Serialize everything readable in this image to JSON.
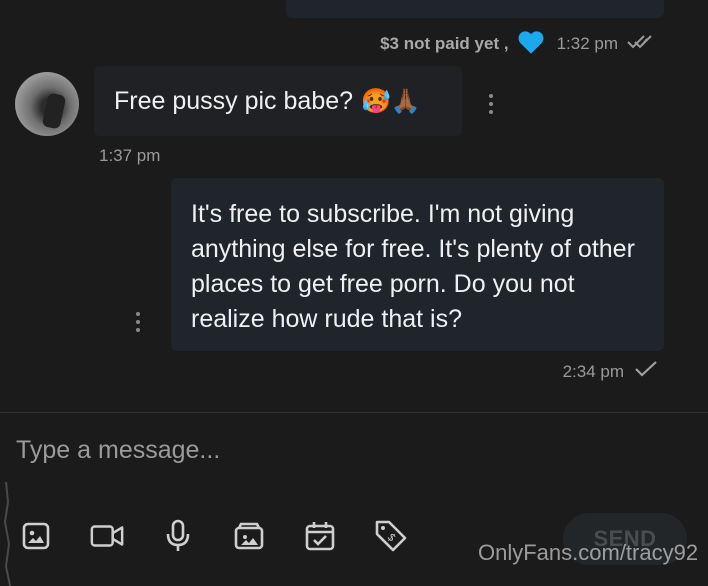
{
  "top_message": {
    "price_status": "$3 not paid yet ,",
    "time": "1:32 pm"
  },
  "received_message": {
    "text": "Free pussy pic babe?",
    "emojis": "🥵🙏🏾",
    "time": "1:37 pm"
  },
  "sent_message": {
    "text": "It's free to subscribe. I'm not giving anything else for free. It's plenty of other places to get free porn. Do you not realize how rude that is?",
    "time": "2:34 pm"
  },
  "composer": {
    "placeholder": "Type a message...",
    "send_label": "SEND",
    "tools": [
      "image-icon",
      "video-icon",
      "microphone-icon",
      "vault-icon",
      "schedule-icon",
      "price-tag-icon"
    ]
  },
  "watermark": "OnlyFans.com/tracy92",
  "colors": {
    "background": "#1b1b1c",
    "bubble_sent": "#20252b",
    "bubble_received": "#1f2125",
    "heart": "#1ba8ec",
    "meta_text": "#9a9a9a"
  }
}
